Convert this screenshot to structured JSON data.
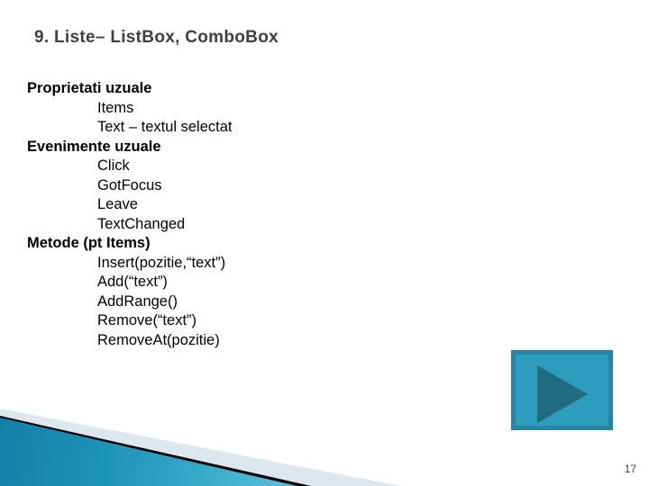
{
  "slide": {
    "title": "9. Liste– ListBox, ComboBox",
    "page_number": "17",
    "title_color": "#404040",
    "accent_color": "#2e9cbd",
    "accent_dark_color": "#1f6b80",
    "accent_border_color": "#2785a3",
    "deco_pale_color": "#dde8ee",
    "deco_black_color": "#000000"
  },
  "content": {
    "lines": [
      {
        "text": "Proprietati uzuale",
        "style": "head"
      },
      {
        "text": "Items",
        "style": "sub"
      },
      {
        "text": "Text – textul selectat",
        "style": "sub"
      },
      {
        "text": "Evenimente uzuale",
        "style": "head"
      },
      {
        "text": "Click",
        "style": "sub"
      },
      {
        "text": "GotFocus",
        "style": "sub"
      },
      {
        "text": "Leave",
        "style": "sub"
      },
      {
        "text": "TextChanged",
        "style": "sub"
      },
      {
        "text": "Metode (pt Items)",
        "style": "head"
      },
      {
        "text": "Insert(pozitie,“text”)",
        "style": "sub"
      },
      {
        "text": "Add(“text”)",
        "style": "sub"
      },
      {
        "text": "AddRange()",
        "style": "sub"
      },
      {
        "text": "Remove(“text”)",
        "style": "sub"
      },
      {
        "text": "RemoveAt(pozitie)",
        "style": "sub"
      }
    ]
  },
  "media": {
    "play_button_label": "play-button"
  }
}
